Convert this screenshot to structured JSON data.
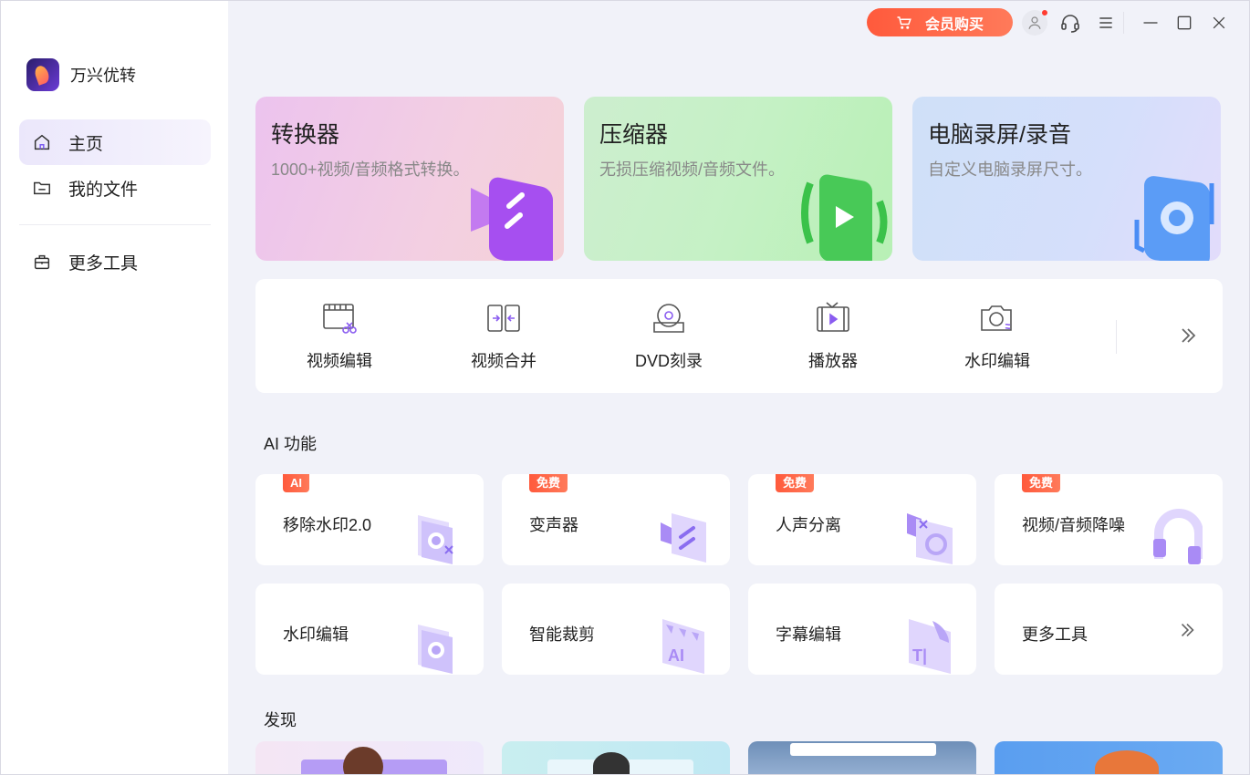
{
  "app": {
    "name": "万兴优转"
  },
  "sidebar": {
    "items": [
      {
        "label": "主页",
        "icon": "home-icon"
      },
      {
        "label": "我的文件",
        "icon": "folder-icon"
      },
      {
        "label": "更多工具",
        "icon": "toolbox-icon"
      }
    ]
  },
  "topbar": {
    "vip_label": "会员购买"
  },
  "features": [
    {
      "title": "转换器",
      "desc": "1000+视频/音频格式转换。",
      "icon": "converter-icon"
    },
    {
      "title": "压缩器",
      "desc": "无损压缩视频/音频文件。",
      "icon": "compressor-icon"
    },
    {
      "title": "电脑录屏/录音",
      "desc": "自定义电脑录屏尺寸。",
      "icon": "screen-recorder-icon"
    }
  ],
  "tools": [
    {
      "label": "视频编辑",
      "icon": "video-edit-icon"
    },
    {
      "label": "视频合并",
      "icon": "video-merge-icon"
    },
    {
      "label": "DVD刻录",
      "icon": "dvd-burn-icon"
    },
    {
      "label": "播放器",
      "icon": "player-icon"
    },
    {
      "label": "水印编辑",
      "icon": "watermark-icon"
    }
  ],
  "ai_section": {
    "title": "AI 功能",
    "cards": [
      {
        "label": "移除水印2.0",
        "badge": "AI",
        "icon": "remove-watermark-icon"
      },
      {
        "label": "变声器",
        "badge": "免费",
        "icon": "voice-changer-icon"
      },
      {
        "label": "人声分离",
        "badge": "免费",
        "icon": "vocal-remover-icon"
      },
      {
        "label": "视频/音频降噪",
        "badge": "免费",
        "icon": "noise-reduction-icon"
      },
      {
        "label": "水印编辑",
        "badge": "",
        "icon": "watermark-edit-icon"
      },
      {
        "label": "智能裁剪",
        "badge": "",
        "icon": "smart-crop-icon"
      },
      {
        "label": "字幕编辑",
        "badge": "",
        "icon": "subtitle-edit-icon"
      },
      {
        "label": "更多工具",
        "badge": "",
        "icon": "chevron-double-right-icon"
      }
    ]
  },
  "discover_section": {
    "title": "发现"
  },
  "colors": {
    "accent": "#7b5cf0",
    "vip": "#ff5a3c",
    "background": "#f1f2f9"
  }
}
